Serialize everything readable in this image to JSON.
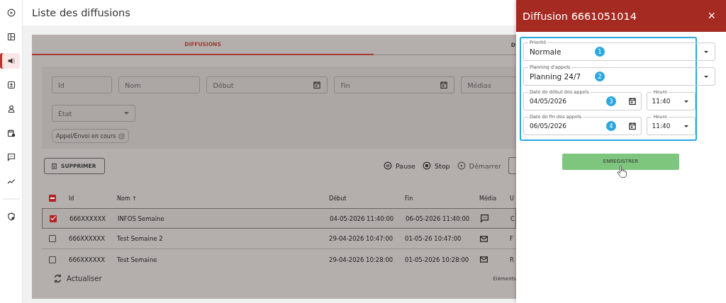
{
  "sidebar": {
    "items": [
      {
        "kind": "play",
        "selected": false
      },
      {
        "kind": "layout",
        "selected": false
      },
      {
        "kind": "megaphone",
        "selected": true
      },
      {
        "kind": "contact",
        "selected": false
      },
      {
        "kind": "person",
        "selected": false
      },
      {
        "kind": "calendar",
        "selected": false
      },
      {
        "kind": "chat",
        "selected": false
      },
      {
        "kind": "chart",
        "selected": false
      },
      {
        "kind": "divider"
      },
      {
        "kind": "shield",
        "selected": false
      }
    ]
  },
  "page": {
    "title": "Liste des diffusions"
  },
  "tabs": [
    {
      "label": "DIFFUSIONS",
      "selected": true
    },
    {
      "label": "D",
      "selected": false
    }
  ],
  "filters": {
    "fields": [
      {
        "label": "Id",
        "kind": "text"
      },
      {
        "label": "Nom",
        "kind": "text"
      },
      {
        "label": "Début",
        "kind": "date"
      },
      {
        "label": "Fin",
        "kind": "date"
      },
      {
        "label": "Médias",
        "kind": "text"
      }
    ],
    "state": {
      "label": "État"
    },
    "chips": [
      "Appel/Envoi en cours"
    ]
  },
  "toolbar": {
    "delete": "SUPPRIMER",
    "actions": [
      {
        "label": "Pause",
        "kind": "pause",
        "disabled": false
      },
      {
        "label": "Stop",
        "kind": "stop",
        "disabled": false
      },
      {
        "label": "Démarrer",
        "kind": "play",
        "disabled": true
      }
    ]
  },
  "table": {
    "select_all": {
      "indeterminate": true
    },
    "columns": [
      "Id",
      "Nom ↑",
      "Début",
      "Fin",
      "Média",
      "U"
    ],
    "rows": [
      {
        "selected": true,
        "checked": true,
        "id": "666XXXXXX",
        "name": "INFOS Semaine",
        "start": "04-05-2026  11:40:00",
        "end": "06-05-2026  11:40:00",
        "media": {
          "kind": "chat"
        },
        "column_6": "C"
      },
      {
        "selected": false,
        "checked": false,
        "id": "666XXXXXX",
        "name": "Test Semaine 2",
        "start": "29-04-2026  10:47:00",
        "end": "01-05-26  10:47:00",
        "media": {
          "kind": "mail"
        },
        "column_6": "F"
      },
      {
        "selected": false,
        "checked": false,
        "id": "666XXXXXX",
        "name": "Test Semaine",
        "start": "29-04-2026  10:28:00",
        "end": "01-05-2026 10:28:00",
        "media": {
          "kind": "mail"
        },
        "column_6": "R"
      }
    ]
  },
  "refresh": "Actualiser",
  "footer": "Éléments",
  "drawer": {
    "title": "Diffusion 6661051014",
    "close": "×",
    "fields": [
      {
        "kind": "select",
        "label": "Priorité",
        "value": "Normale",
        "marker": "1"
      },
      {
        "kind": "select",
        "label": "Planning d'appels",
        "value": "Planning 24/7",
        "marker": "2"
      },
      {
        "kind": "datetime",
        "label": "Date de début des appels",
        "value": "04/05/2026",
        "marker": "3",
        "time_label": "Heure",
        "time": "11:40"
      },
      {
        "kind": "datetime",
        "label": "Date de fin des appels",
        "value": "06/05/2026",
        "marker": "4",
        "time_label": "Heure",
        "time": "11:40"
      }
    ],
    "save": "ENREGISTRER"
  }
}
